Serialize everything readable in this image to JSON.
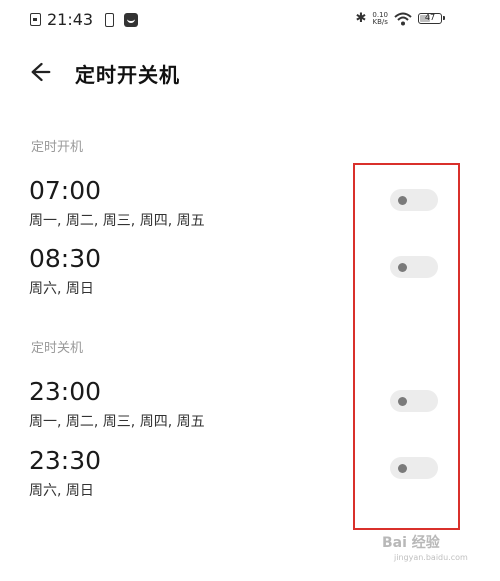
{
  "status_bar": {
    "time": "21:43",
    "net_speed_value": "0.10",
    "net_speed_unit": "KB/s",
    "battery": "47",
    "battery_level": 0.47
  },
  "header": {
    "title": "定时开关机"
  },
  "sections": [
    {
      "label": "定时开机",
      "schedules": [
        {
          "time": "07:00",
          "days": "周一, 周二, 周三, 周四, 周五",
          "enabled": false
        },
        {
          "time": "08:30",
          "days": "周六, 周日",
          "enabled": false
        }
      ]
    },
    {
      "label": "定时关机",
      "schedules": [
        {
          "time": "23:00",
          "days": "周一, 周二, 周三, 周四, 周五",
          "enabled": false
        },
        {
          "time": "23:30",
          "days": "周六, 周日",
          "enabled": false
        }
      ]
    }
  ],
  "watermark": {
    "brand": "Bai 经验",
    "url": "jingyan.baidu.com"
  },
  "colors": {
    "highlight": "#d9302b",
    "toggle_off_track": "#ececec",
    "toggle_off_knob": "#7a7a7a"
  }
}
